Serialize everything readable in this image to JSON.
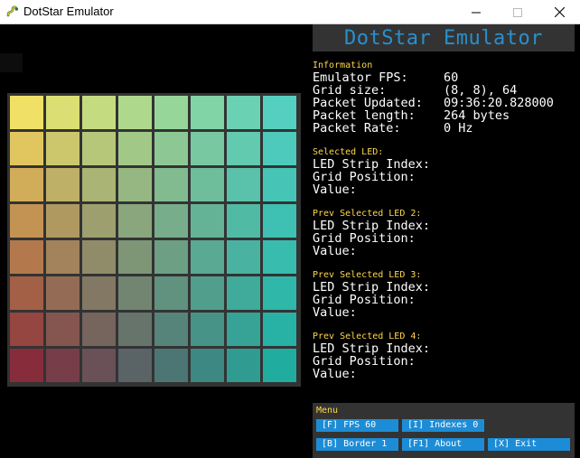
{
  "window": {
    "title": "DotStar Emulator",
    "icons": [
      "pygame-snake-icon",
      "minimize-icon",
      "maximize-icon",
      "close-icon"
    ]
  },
  "header": {
    "title": "DotStar Emulator",
    "color": "#2a8fcc"
  },
  "info": {
    "title": "Information",
    "rows": [
      {
        "label": "Emulator FPS:",
        "value": "60"
      },
      {
        "label": "Grid size:",
        "value": "(8, 8), 64"
      },
      {
        "label": "Packet Updated:",
        "value": "09:36:20.828000"
      },
      {
        "label": "Packet length:",
        "value": "264 bytes"
      },
      {
        "label": "Packet Rate:",
        "value": "0 Hz"
      }
    ]
  },
  "selections": [
    {
      "title": "Selected LED:",
      "labels": [
        "LED Strip Index:",
        "Grid Position:",
        "Value:"
      ]
    },
    {
      "title": "Prev Selected LED 2:",
      "labels": [
        "LED Strip Index:",
        "Grid Position:",
        "Value:"
      ]
    },
    {
      "title": "Prev Selected LED 3:",
      "labels": [
        "LED Strip Index:",
        "Grid Position:",
        "Value:"
      ]
    },
    {
      "title": "Prev Selected LED 4:",
      "labels": [
        "LED Strip Index:",
        "Grid Position:",
        "Value:"
      ]
    }
  ],
  "menu": {
    "title": "Menu",
    "buttons": [
      {
        "label": "[F] FPS 60",
        "name": "fps-button"
      },
      {
        "label": "[I] Indexes 0",
        "name": "indexes-button"
      },
      {
        "label": "[B] Border 1",
        "name": "border-button"
      },
      {
        "label": "[F1] About",
        "name": "about-button"
      },
      {
        "label": "[X] Exit",
        "name": "exit-button"
      }
    ]
  },
  "grid": {
    "size": [
      8,
      8
    ],
    "corner_colors": {
      "top_left": "#f0e066",
      "top_right": "#55cfc0",
      "bottom_left": "#862c3a",
      "bottom_right": "#20ada0"
    }
  },
  "colors": {
    "background": "#000000",
    "panel": "#333333",
    "section_title": "#ffd84a",
    "button": "#1d8cd6"
  }
}
